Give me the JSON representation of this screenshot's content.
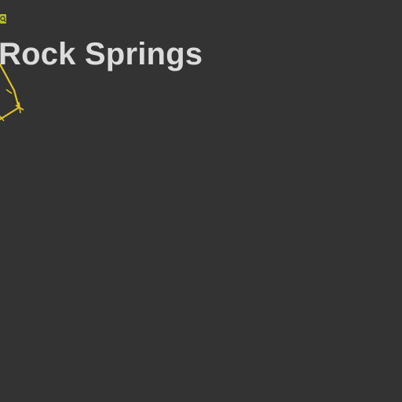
{
  "map": {
    "place_label": "Rock Springs",
    "background_color": "#333333",
    "route_color": "#e2c22a",
    "marker_color": "#b5c21a",
    "marker_icon": "road-shield-icon"
  }
}
